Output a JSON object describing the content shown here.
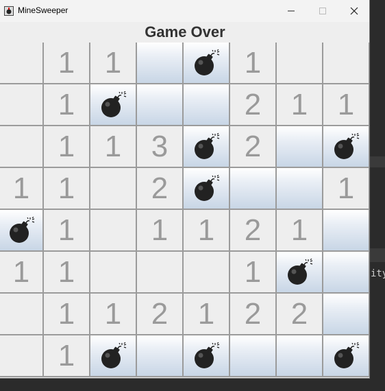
{
  "window": {
    "title": "MineSweeper",
    "controls": {
      "minimize": "minimize-icon",
      "maximize": "maximize-icon",
      "close": "close-icon"
    }
  },
  "status": {
    "message": "Game Over"
  },
  "colors": {
    "number": "#9a9a9a",
    "revealed": "#eeeeee",
    "hidden_top": "#ffffff",
    "hidden_bottom": "#c8d6e6"
  },
  "background_text": "ity",
  "board": {
    "rows": 8,
    "cols": 8,
    "cells": [
      [
        "",
        "1",
        "1",
        "#",
        "*",
        "1",
        "",
        ""
      ],
      [
        "",
        "1",
        "*",
        "#",
        "#",
        "2",
        "1",
        "1"
      ],
      [
        "",
        "1",
        "1",
        "3",
        "*",
        "2",
        "#",
        "*"
      ],
      [
        "1",
        "1",
        "",
        "2",
        "*",
        "#",
        "#",
        "1"
      ],
      [
        "*",
        "1",
        "",
        "1",
        "1",
        "2",
        "1",
        "#"
      ],
      [
        "1",
        "1",
        "",
        "",
        "",
        "1",
        "*",
        "#"
      ],
      [
        "",
        "1",
        "1",
        "2",
        "1",
        "2",
        "2",
        "#"
      ],
      [
        "",
        "1",
        "*",
        "#",
        "*",
        "#",
        "#",
        "*"
      ]
    ]
  }
}
